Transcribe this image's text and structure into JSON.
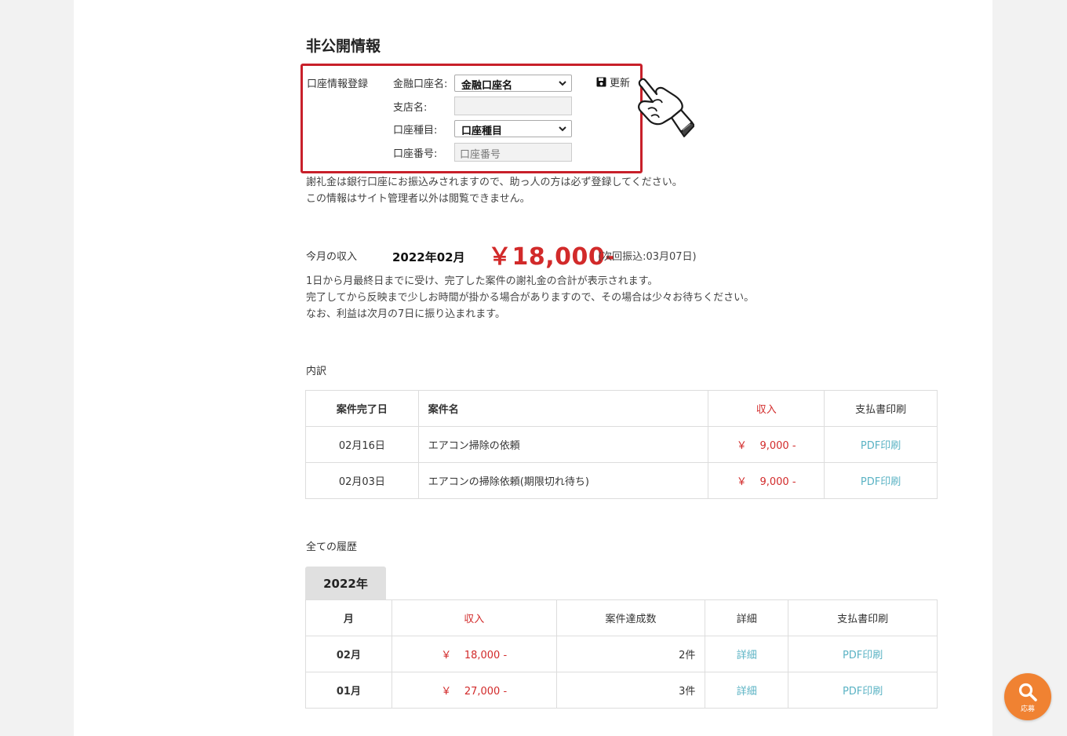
{
  "section_title": "非公開情報",
  "bank_form": {
    "label": "口座情報登録",
    "bank_name_label": "金融口座名:",
    "bank_name_value": "金融口座名",
    "branch_label": "支店名:",
    "branch_value": "",
    "account_type_label": "口座種目:",
    "account_type_value": "口座種目",
    "account_number_label": "口座番号:",
    "account_number_placeholder": "口座番号",
    "update_label": "更新"
  },
  "bank_notes": [
    "謝礼金は銀行口座にお振込みされますので、助っ人の方は必ず登録してください。",
    "この情報はサイト管理者以外は閲覧できません。"
  ],
  "income": {
    "label": "今月の収入",
    "month": "2022年02月",
    "amount": "￥18,000-",
    "next_payment": "(次回振込:03月07日)",
    "notes": [
      "1日から月最終日までに受け、完了した案件の謝礼金の合計が表示されます。",
      "完了してから反映まで少しお時間が掛かる場合がありますので、その場合は少々お待ちください。",
      "なお、利益は次月の7日に振り込まれます。"
    ]
  },
  "breakdown": {
    "title": "内訳",
    "headers": [
      "案件完了日",
      "案件名",
      "収入",
      "支払書印刷"
    ],
    "rows": [
      {
        "date": "02月16日",
        "name": "エアコン掃除の依頼",
        "yen": "￥",
        "amount": "9,000 -",
        "print": "PDF印刷"
      },
      {
        "date": "02月03日",
        "name": "エアコンの掃除依頼(期限切れ待ち)",
        "yen": "￥",
        "amount": "9,000 -",
        "print": "PDF印刷"
      }
    ]
  },
  "history": {
    "title": "全ての履歴",
    "year_tab": "2022年",
    "headers": [
      "月",
      "収入",
      "案件達成数",
      "詳細",
      "支払書印刷"
    ],
    "rows": [
      {
        "month": "02月",
        "yen": "￥",
        "amount": "18,000 -",
        "count": "2件",
        "detail": "詳細",
        "print": "PDF印刷"
      },
      {
        "month": "01月",
        "yen": "￥",
        "amount": "27,000 -",
        "count": "3件",
        "detail": "詳細",
        "print": "PDF印刷"
      }
    ]
  },
  "fab": {
    "label": "応募",
    "icon": "search-icon"
  },
  "colors": {
    "accent_red": "#d22a2a",
    "highlight_border": "#c8202a",
    "link": "#5bb3c4",
    "fab": "#f08232"
  }
}
